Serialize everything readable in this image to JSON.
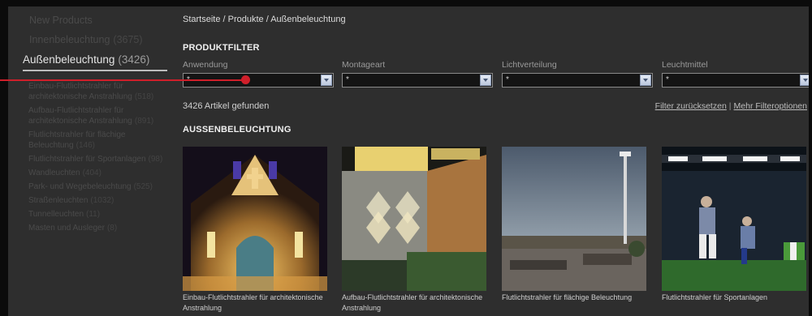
{
  "sidebar": {
    "top_items": [
      {
        "label": "New Products",
        "count": ""
      },
      {
        "label": "Innenbeleuchtung",
        "count": "(3675)"
      }
    ],
    "active": {
      "label": "Außenbeleuchtung",
      "count": "(3426)"
    },
    "sub_items": [
      {
        "label": "Einbau-Flutlichtstrahler für architektonische Anstrahlung",
        "count": "(518)"
      },
      {
        "label": "Aufbau-Flutlichtstrahler für architektonische Anstrahlung",
        "count": "(891)"
      },
      {
        "label": "Flutlichtstrahler für flächige Beleuchtung",
        "count": "(146)"
      },
      {
        "label": "Flutlichtstrahler für Sportanlagen",
        "count": "(98)"
      },
      {
        "label": "Wandleuchten",
        "count": "(404)"
      },
      {
        "label": "Park- und Wegebeleuchtung",
        "count": "(525)"
      },
      {
        "label": "Straßenleuchten",
        "count": "(1032)"
      },
      {
        "label": "Tunnelleuchten",
        "count": "(11)"
      },
      {
        "label": "Masten und Ausleger",
        "count": "(8)"
      }
    ]
  },
  "breadcrumb": "Startseite / Produkte / Außenbeleuchtung",
  "filter_title": "PRODUKTFILTER",
  "filters": [
    {
      "label": "Anwendung",
      "value": "*"
    },
    {
      "label": "Montageart",
      "value": "*"
    },
    {
      "label": "Lichtverteilung",
      "value": "*"
    },
    {
      "label": "Leuchtmittel",
      "value": "*"
    }
  ],
  "results_text": "3426 Artikel gefunden",
  "filter_links": {
    "reset": "Filter zurücksetzen",
    "separator": "|",
    "more": "Mehr Filteroptionen"
  },
  "section_title": "AUSSENBELEUCHTUNG",
  "products": [
    {
      "caption": "Einbau-Flutlichtstrahler für architektonische Anstrahlung"
    },
    {
      "caption": "Aufbau-Flutlichtstrahler für architektonische Anstrahlung"
    },
    {
      "caption": "Flutlichtstrahler für flächige Beleuchtung"
    },
    {
      "caption": "Flutlichtstrahler für Sportanlagen"
    }
  ],
  "colors": {
    "background": "#2e2e2e",
    "pointer": "#d01f2a",
    "select_arrow": "#c4cfe3"
  }
}
